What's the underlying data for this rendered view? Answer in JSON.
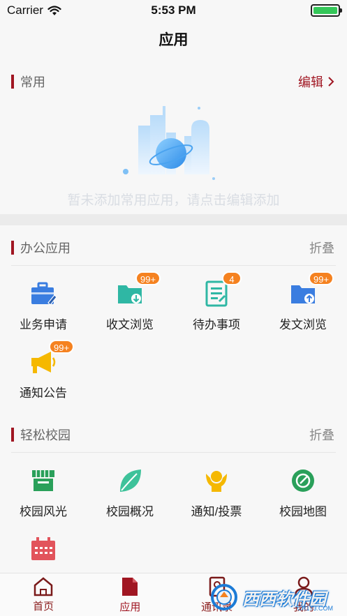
{
  "status_bar": {
    "carrier": "Carrier",
    "time": "5:53 PM"
  },
  "nav": {
    "title": "应用"
  },
  "common": {
    "title": "常用",
    "edit_label": "编辑",
    "empty_text": "暂未添加常用应用，请点击编辑添加"
  },
  "office": {
    "title": "办公应用",
    "fold_label": "折叠",
    "items": [
      {
        "label": "业务申请",
        "icon": "briefcase-edit-icon",
        "badge": ""
      },
      {
        "label": "收文浏览",
        "icon": "folder-download-icon",
        "badge": "99+"
      },
      {
        "label": "待办事项",
        "icon": "document-list-icon",
        "badge": "4"
      },
      {
        "label": "发文浏览",
        "icon": "folder-upload-icon",
        "badge": "99+"
      },
      {
        "label": "通知公告",
        "icon": "megaphone-icon",
        "badge": "99+"
      }
    ]
  },
  "campus": {
    "title": "轻松校园",
    "fold_label": "折叠",
    "items": [
      {
        "label": "校园风光",
        "icon": "storefront-icon"
      },
      {
        "label": "校园概况",
        "icon": "leaf-icon"
      },
      {
        "label": "通知/投票",
        "icon": "vote-hands-icon"
      },
      {
        "label": "校园地图",
        "icon": "map-compass-icon"
      },
      {
        "label": "",
        "icon": "calendar-icon"
      }
    ]
  },
  "tab_bar": {
    "items": [
      {
        "label": "首页",
        "icon": "home-icon"
      },
      {
        "label": "应用",
        "icon": "apps-icon"
      },
      {
        "label": "通讯录",
        "icon": "contacts-icon"
      },
      {
        "label": "我的",
        "icon": "profile-icon"
      }
    ],
    "active_index": 1
  },
  "watermark": {
    "text": "西西软件园",
    "url": "CR173.COM"
  },
  "colors": {
    "accent": "#a01622",
    "badge": "#f58220",
    "blue_icon": "#3a7de0",
    "teal_icon": "#2fb7a4",
    "green_icon": "#2aa05a",
    "yellow_icon": "#f5b800",
    "red_icon": "#e2545c"
  }
}
